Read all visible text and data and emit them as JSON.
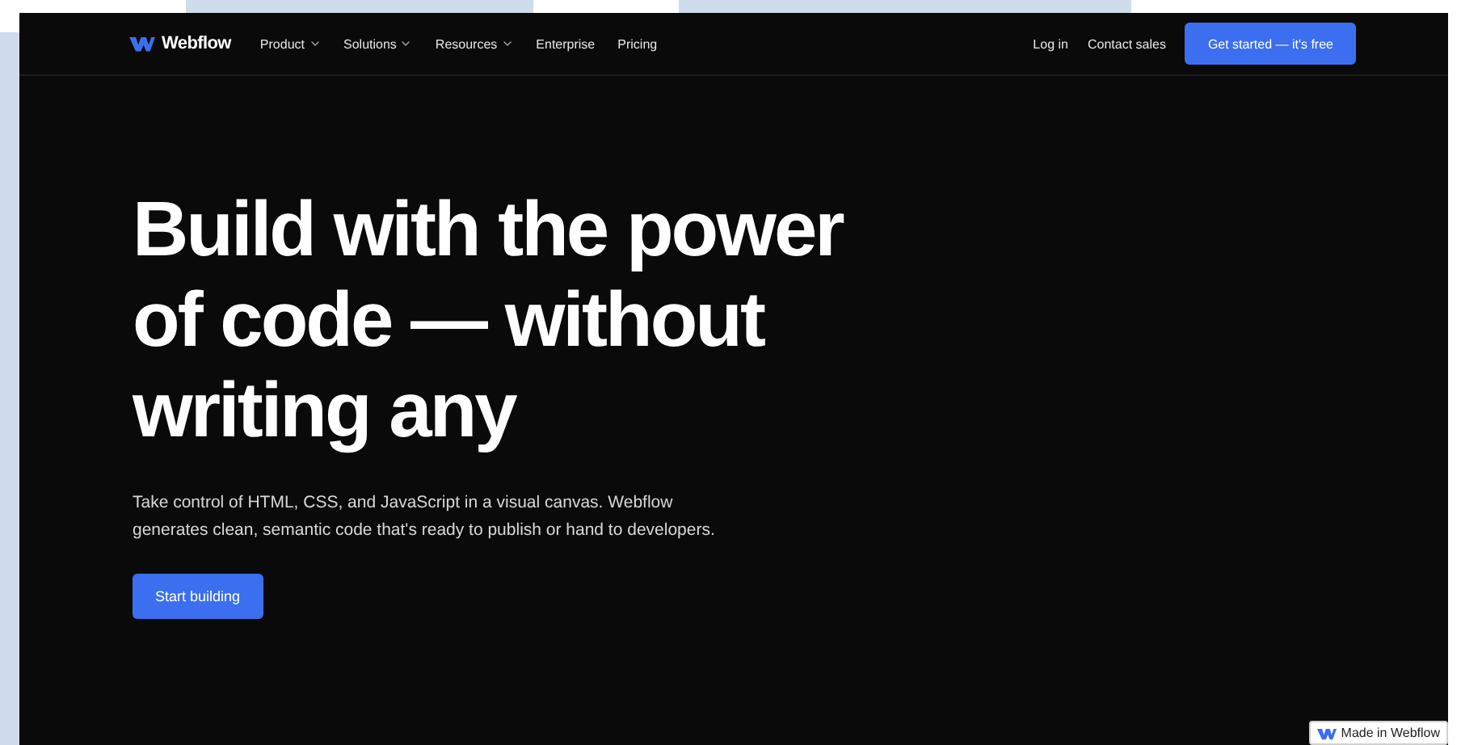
{
  "nav": {
    "brand": "Webflow",
    "links": [
      {
        "label": "Product",
        "dropdown": true
      },
      {
        "label": "Solutions",
        "dropdown": true
      },
      {
        "label": "Resources",
        "dropdown": true
      },
      {
        "label": "Enterprise",
        "dropdown": false
      },
      {
        "label": "Pricing",
        "dropdown": false
      }
    ],
    "actions": [
      {
        "label": "Log in",
        "kind": "link"
      },
      {
        "label": "Contact sales",
        "kind": "link"
      },
      {
        "label": "Get started — it's free",
        "kind": "button"
      }
    ]
  },
  "hero": {
    "heading": "Build with the power of code — without writing any",
    "description": "Take control of HTML, CSS, and JavaScript in a visual canvas. Webflow generates clean, semantic code that's ready to publish or hand to developers.",
    "cta": "Start building"
  },
  "badge": {
    "label": "Made in Webflow"
  }
}
